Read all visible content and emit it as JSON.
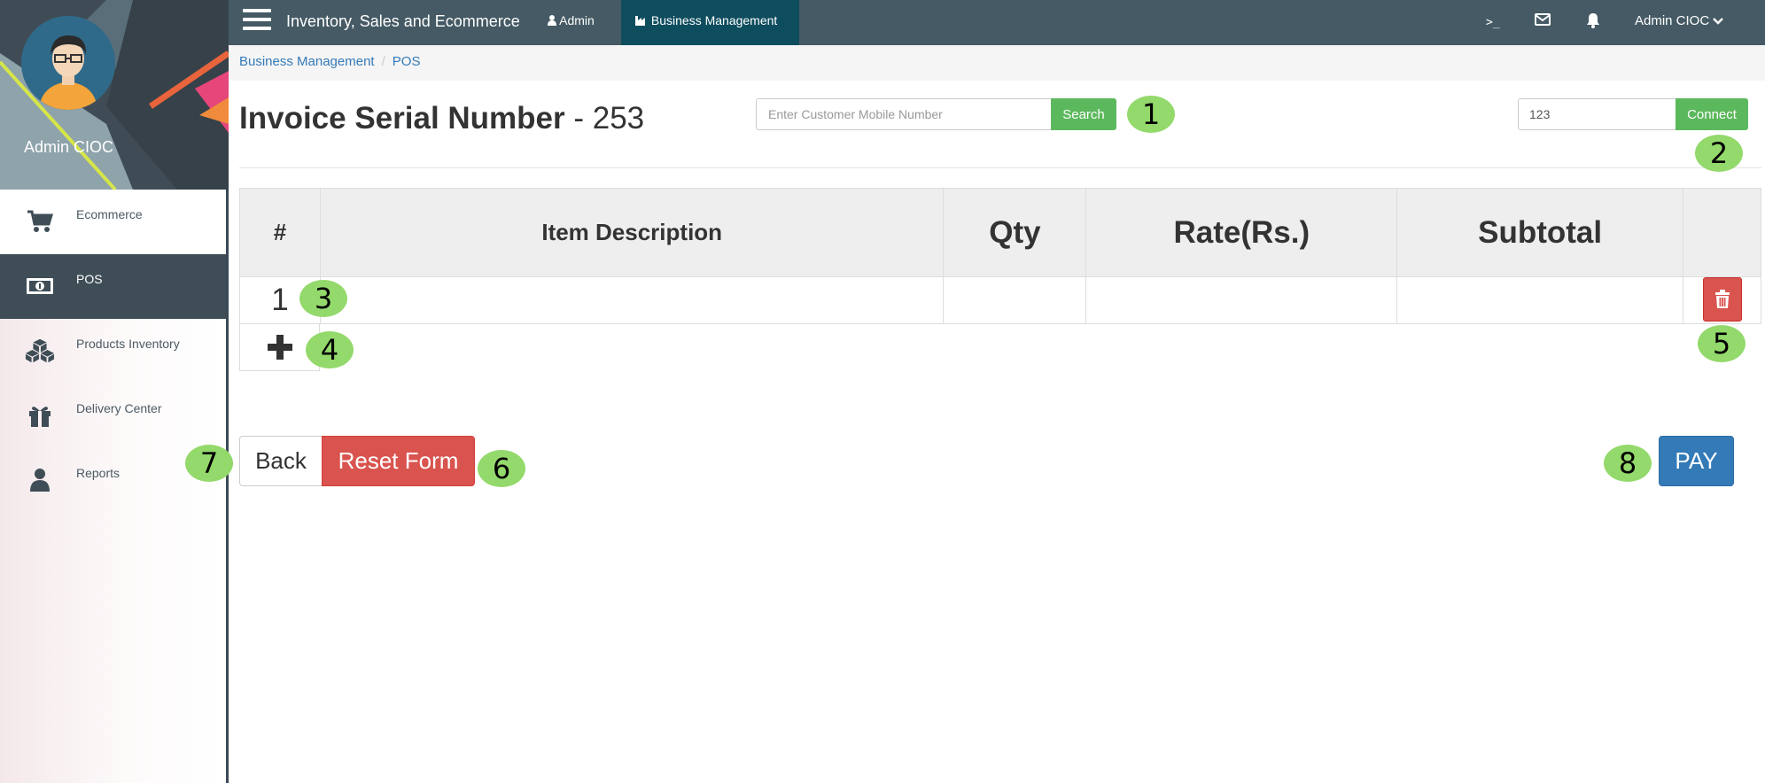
{
  "sidebar": {
    "username": "Admin CIOC",
    "items": [
      {
        "label": "Ecommerce",
        "icon": "cart-icon"
      },
      {
        "label": "POS",
        "icon": "money-icon"
      },
      {
        "label": "Products Inventory",
        "icon": "cubes-icon"
      },
      {
        "label": "Delivery Center",
        "icon": "gift-icon"
      },
      {
        "label": "Reports",
        "icon": "user-icon"
      }
    ]
  },
  "topbar": {
    "title": "Inventory, Sales and Ecommerce",
    "tab_admin": "Admin",
    "tab_business": "Business Management",
    "terminal": ">_",
    "user": "Admin CIOC",
    "background": "#455a64",
    "active_tab_color": "#0e4d5e"
  },
  "breadcrumb": {
    "first": "Business Management",
    "second": "POS"
  },
  "invoice": {
    "label": "Invoice Serial Number",
    "sep": " - ",
    "number": "253"
  },
  "search": {
    "placeholder": "Enter Customer Mobile Number",
    "value": "",
    "button": "Search"
  },
  "connect": {
    "value": "123",
    "button": "Connect"
  },
  "table": {
    "headers": [
      "#",
      "Item Description",
      "Qty",
      "Rate(Rs.)",
      "Subtotal",
      ""
    ],
    "rows": [
      {
        "num": "1",
        "description": "",
        "qty": "",
        "rate": "",
        "subtotal": ""
      }
    ]
  },
  "buttons": {
    "back": "Back",
    "reset": "Reset Form",
    "pay": "PAY"
  },
  "markers": [
    "1",
    "2",
    "3",
    "4",
    "5",
    "6",
    "7",
    "8"
  ],
  "colors": {
    "success": "#5cb85c",
    "danger": "#d9534f",
    "primary": "#337ab7",
    "marker": "#93d96b"
  }
}
